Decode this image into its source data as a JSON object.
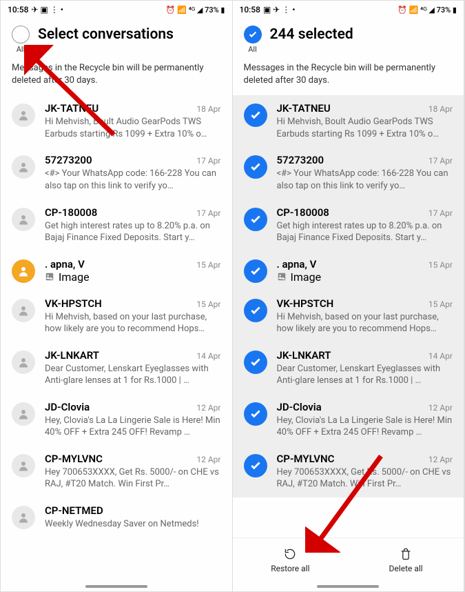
{
  "status": {
    "time": "10:58",
    "battery": "73%"
  },
  "left": {
    "all_label": "All",
    "title": "Select conversations",
    "subtitle": "Messages in the Recycle bin will be permanently deleted after 30 days.",
    "items": [
      {
        "sender": "JK-TATNEU",
        "date": "18 Apr",
        "preview": "Hi Mehvish, Boult Audio GearPods TWS Earbuds starting Rs 1099 + Extra 10% o…"
      },
      {
        "sender": "57273200",
        "date": "17 Apr",
        "preview": "<#> Your WhatsApp code: 166-228 You can also tap on this link to verify yo…"
      },
      {
        "sender": "CP-180008",
        "date": "17 Apr",
        "preview": "Get high interest rates up to 8.20% p.a. on Bajaj Finance Fixed Deposits. Start y…"
      },
      {
        "sender": ". apna, V",
        "date": "15 Apr",
        "preview": "Image",
        "image": true,
        "color_avatar": true
      },
      {
        "sender": "VK-HPSTCH",
        "date": "15 Apr",
        "preview": "Hi Mehvish, based on your last purchase, how likely are you to recommend Hops…"
      },
      {
        "sender": "JK-LNKART",
        "date": "14 Apr",
        "preview": "Dear Customer, Lenskart Eyeglasses with Anti-glare lenses at 1 for Rs.1000 | …"
      },
      {
        "sender": "JD-Clovia",
        "date": "12 Apr",
        "preview": "Hey, Clovia's La La Lingerie Sale is Here! Min 40% OFF + Extra 245 OFF! Revamp …"
      },
      {
        "sender": "CP-MYLVNC",
        "date": "12 Apr",
        "preview": "Hey 700653XXXX,   Get Rs. 5000/- on CHE vs RAJ,   #T20 Match.   Win First Pr…"
      },
      {
        "sender": "CP-NETMED",
        "date": "",
        "preview": "Weekly Wednesday Saver on Netmeds!"
      }
    ]
  },
  "right": {
    "all_label": "All",
    "title": "244 selected",
    "subtitle": "Messages in the Recycle bin will be permanently deleted after 30 days.",
    "items": [
      {
        "sender": "JK-TATNEU",
        "date": "18 Apr",
        "preview": "Hi Mehvish, Boult Audio GearPods TWS Earbuds starting Rs 1099 + Extra 10% o…"
      },
      {
        "sender": "57273200",
        "date": "17 Apr",
        "preview": "<#> Your WhatsApp code: 166-228 You can also tap on this link to verify yo…"
      },
      {
        "sender": "CP-180008",
        "date": "17 Apr",
        "preview": "Get high interest rates up to 8.20% p.a. on Bajaj Finance Fixed Deposits. Start y…"
      },
      {
        "sender": ". apna, V",
        "date": "15 Apr",
        "preview": "Image",
        "image": true
      },
      {
        "sender": "VK-HPSTCH",
        "date": "15 Apr",
        "preview": "Hi Mehvish, based on your last purchase, how likely are you to recommend Hops…"
      },
      {
        "sender": "JK-LNKART",
        "date": "14 Apr",
        "preview": "Dear Customer, Lenskart Eyeglasses with Anti-glare lenses at 1 for Rs.1000 | …"
      },
      {
        "sender": "JD-Clovia",
        "date": "12 Apr",
        "preview": "Hey, Clovia's La La Lingerie Sale is Here! Min 40% OFF + Extra 245 OFF! Revamp …"
      },
      {
        "sender": "CP-MYLVNC",
        "date": "12 Apr",
        "preview": "Hey 700653XXXX,   Get Rs. 5000/- on CHE vs RAJ,   #T20 Match.   Win First Pr…"
      }
    ],
    "restore_label": "Restore all",
    "delete_label": "Delete all"
  }
}
